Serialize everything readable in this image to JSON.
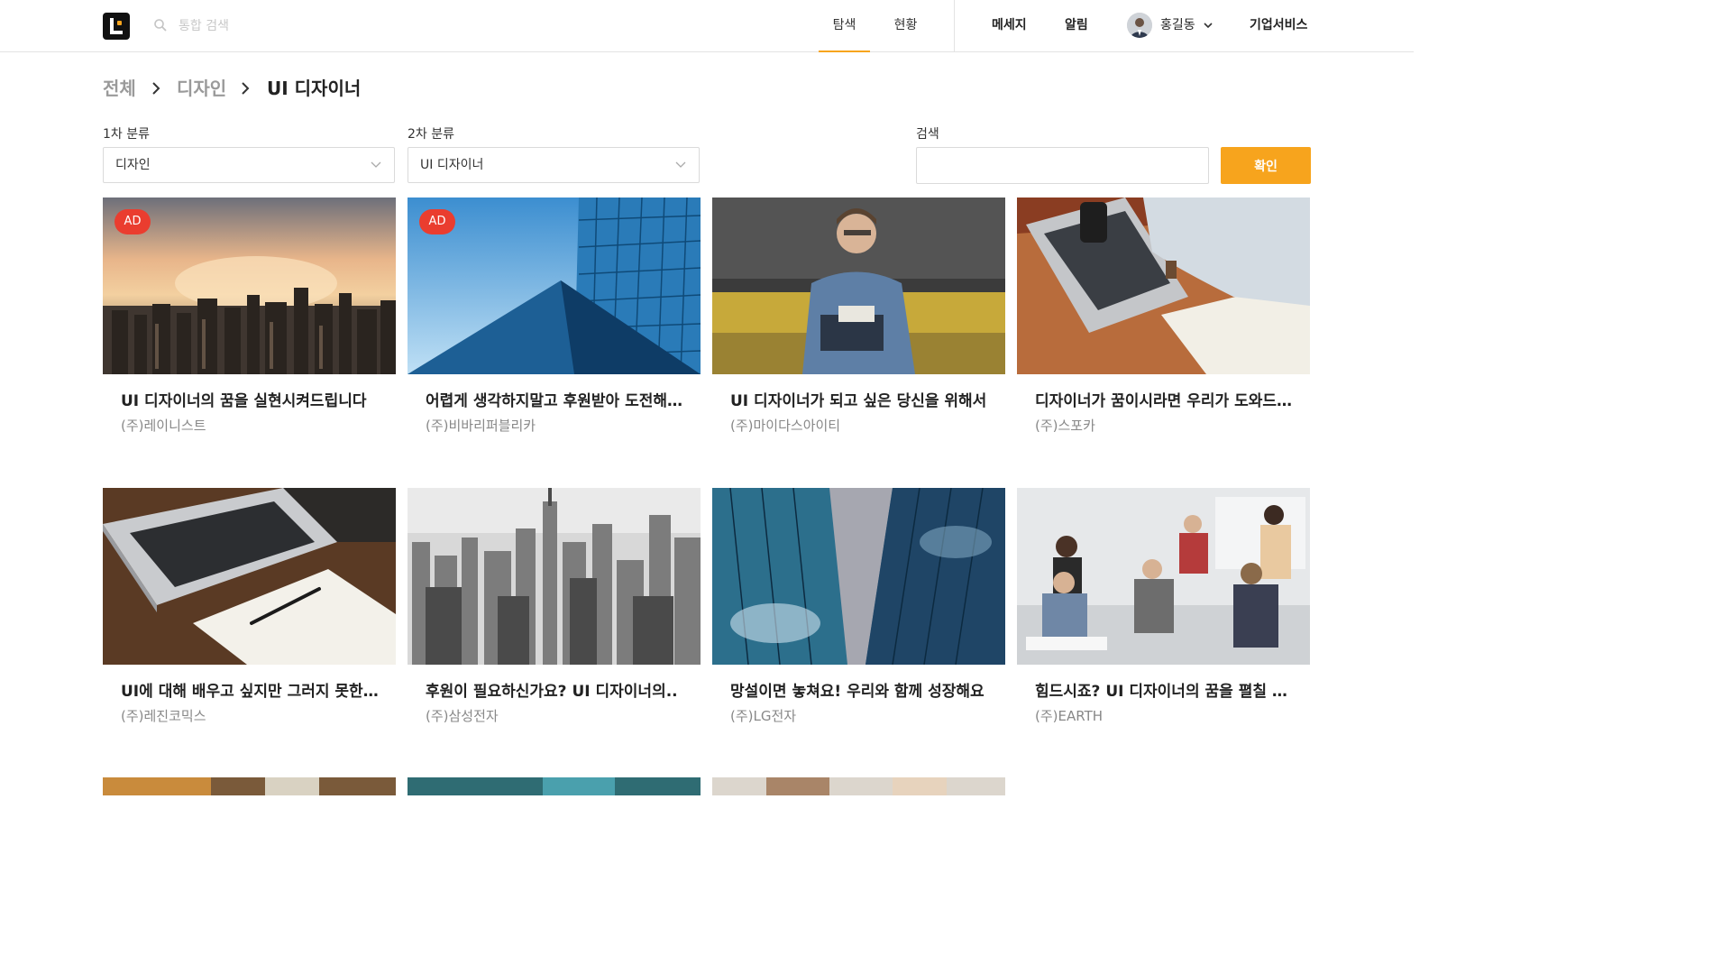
{
  "header": {
    "search_placeholder": "통합 검색",
    "tabs": [
      {
        "label": "탐색"
      },
      {
        "label": "현황"
      }
    ],
    "links": {
      "messages": "메세지",
      "alerts": "알림",
      "business": "기업서비스"
    },
    "user_name": "홍길동",
    "accent_color": "#f7a41d"
  },
  "breadcrumb": [
    "전체",
    "디자인",
    "UI 디자이너"
  ],
  "filters": {
    "first_label": "1차 분류",
    "first_value": "디자인",
    "second_label": "2차 분류",
    "second_value": "UI 디자이너",
    "search_label": "검색",
    "search_value": "",
    "confirm_label": "확인"
  },
  "cards": [
    {
      "title": "UI 디자이너의 꿈을 실현시켜드립니다",
      "company": "(주)레이니스트",
      "ad": "AD"
    },
    {
      "title": "어렵게 생각하지말고 후원받아 도전해보세요",
      "company": "(주)비바리퍼블리카",
      "ad": "AD"
    },
    {
      "title": "UI 디자이너가 되고 싶은 당신을 위해서",
      "company": "(주)마이다스아이티"
    },
    {
      "title": "디자이너가 꿈이시라면 우리가 도와드립니다",
      "company": "(주)스포카"
    },
    {
      "title": "UI에 대해 배우고 싶지만 그러지 못한다면",
      "company": "(주)레진코믹스"
    },
    {
      "title": "후원이 필요하신가요? UI 디자이너의..",
      "company": "(주)삼성전자"
    },
    {
      "title": "망설이면 놓쳐요! 우리와 함께 성장해요",
      "company": "(주)LG전자"
    },
    {
      "title": "힘드시죠? UI 디자이너의 꿈을 펼칠 수 있습니다",
      "company": "(주)EARTH"
    }
  ]
}
